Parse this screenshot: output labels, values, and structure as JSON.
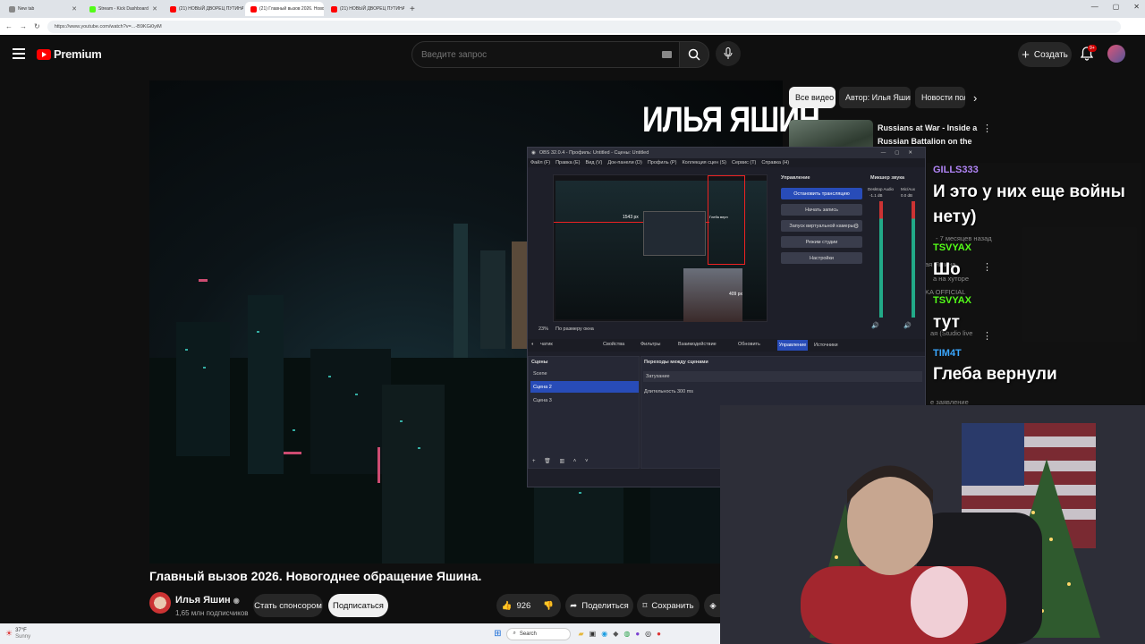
{
  "browser": {
    "tabs": [
      {
        "label": "New tab",
        "color": "#888888",
        "active": false
      },
      {
        "label": "Stream - Kick Dashboard",
        "color": "#53fc18",
        "active": false
      },
      {
        "label": "(21) НОВЫЙ ДВОРЕЦ ПУТИНА. П",
        "color": "#ff0000",
        "active": false
      },
      {
        "label": "(21) Главный вызов 2026. Новог",
        "color": "#ff0000",
        "active": true
      },
      {
        "label": "(21) НОВЫЙ ДВОРЕЦ ПУТИНА. П",
        "color": "#ff0000",
        "active": false
      }
    ],
    "url": "https://www.youtube.com/watch?v=...-B9KGi0yiM"
  },
  "youtube": {
    "logo": "Premium",
    "search_placeholder": "Введите запрос",
    "create": "Создать",
    "notif_count": "9+",
    "video_overlay_title": "ИЛЬЯ ЯШИН",
    "video_title": "Главный вызов 2026. Новогоднее обращение Яшина.",
    "channel": "Илья Яшин",
    "subscribers": "1,65 млн подписчиков",
    "sponsor": "Стать спонсором",
    "subscribe": "Подписаться",
    "likes": "926",
    "share": "Поделиться",
    "save": "Сохранить",
    "chips": [
      "Все видео",
      "Автор: Илья Яшин",
      "Новости пол"
    ],
    "related_title": "Russians at War - Inside a Russian Battalion on the Front ..."
  },
  "chat": [
    {
      "name": "GILLS333",
      "name_color": "#b084f5",
      "msg": "И это у них еще войны нету)"
    },
    {
      "name": "TSVYAX",
      "name_color": "#53fc18",
      "msg": "Шо"
    },
    {
      "name": "TSVYAX",
      "name_color": "#53fc18",
      "msg": "тут"
    },
    {
      "name": "TIM4T",
      "name_color": "#3aa7ff",
      "msg": "Глеба вернули"
    }
  ],
  "chat_ghost": [
    "- 7 месяцев назад",
    "ая Яшина",
    "а на хуторе",
    "KA OFFICIAL",
    "ая (Studio live",
    "е заявление"
  ],
  "obs": {
    "title": "OBS 32.0.4 - Профиль: Untitled - Сцены: Untitled",
    "menu": [
      "Файл (F)",
      "Правка (E)",
      "Вид (V)",
      "Док-панели (D)",
      "Профиль (P)",
      "Коллекция сцен (S)",
      "Сервис (T)",
      "Справка (H)"
    ],
    "controls_title": "Управление",
    "controls": [
      "Остановить трансляцию",
      "Начать запись",
      "Запуск виртуальной камеры",
      "Режим студии",
      "Настройки"
    ],
    "mixer_title": "Микшер звука",
    "mixer_channels": [
      "Desktop Audio",
      "Mic/Aux"
    ],
    "mixer_db": [
      "-1.1 dB",
      "0.0 dB"
    ],
    "zoom": "23%",
    "zoom_mode": "По размеру окна",
    "source_name": "чатик",
    "source_buttons": [
      "Свойства",
      "Фильтры",
      "Взаимодействие",
      "Обновить"
    ],
    "tabs": [
      "Управление",
      "Источники"
    ],
    "scenes_title": "Сцены",
    "scenes": [
      "Scene",
      "Сцена 2",
      "Сцена 3"
    ],
    "selected_scene": 1,
    "transitions_title": "Переходы между сценами",
    "transition": "Затухание",
    "duration_label": "Длительность",
    "duration": "300 ms",
    "preview_labels": [
      "1543 px",
      "409 px",
      "Глеба верн"
    ]
  },
  "taskbar": {
    "weather": "37°F",
    "weather_sub": "Sunny",
    "search": "Search"
  }
}
